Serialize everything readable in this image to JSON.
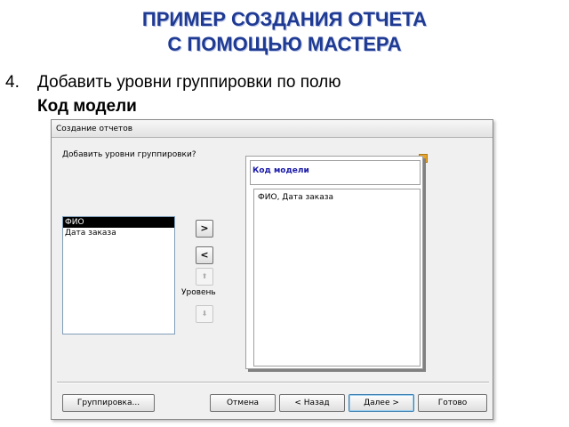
{
  "slide": {
    "title_line1": "ПРИМЕР СОЗДАНИЯ ОТЧЕТА",
    "title_line2": "С ПОМОЩЬЮ МАСТЕРА",
    "step_number": "4.",
    "step_text": "Добавить уровни группировки по полю",
    "step_field": "Код модели"
  },
  "dialog": {
    "title": "Создание отчетов",
    "prompt": "Добавить уровни группировки?",
    "available_fields": [
      {
        "label": "ФИО",
        "selected": true
      },
      {
        "label": "Дата заказа",
        "selected": false
      }
    ],
    "buttons": {
      "add": ">",
      "remove": "<",
      "up": "⬆",
      "down": "⬇",
      "level_label": "Уровень"
    },
    "preview": {
      "group_field": "Код модели",
      "detail_fields": "ФИО, Дата заказа"
    },
    "footer": {
      "grouping": "Группировка...",
      "cancel": "Отмена",
      "back": "< Назад",
      "next": "Далее >",
      "finish": "Готово"
    }
  }
}
